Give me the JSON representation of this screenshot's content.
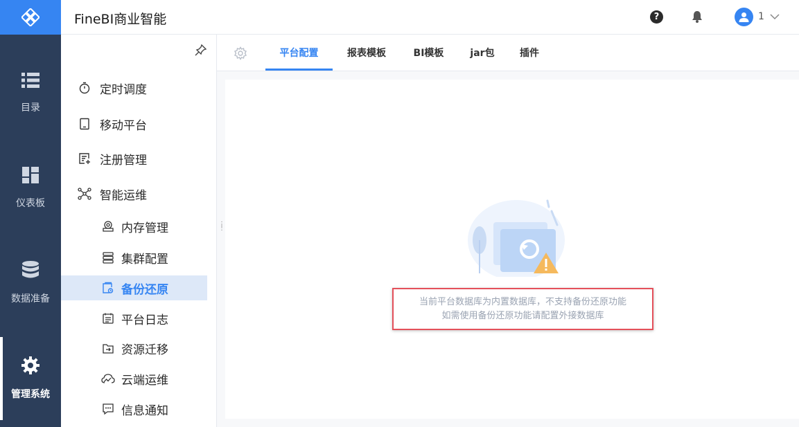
{
  "app": {
    "title": "FineBI商业智能"
  },
  "rail": {
    "items": [
      {
        "label": "目录",
        "icon": "list-icon"
      },
      {
        "label": "仪表板",
        "icon": "dashboard-icon"
      },
      {
        "label": "数据准备",
        "icon": "database-icon"
      },
      {
        "label": "管理系统",
        "icon": "gear-icon",
        "active": true
      }
    ]
  },
  "header": {
    "help_icon": "?",
    "user_label": "1"
  },
  "sidebar": {
    "items": [
      {
        "label": "定时调度",
        "icon": "timer-icon"
      },
      {
        "label": "移动平台",
        "icon": "tablet-icon"
      },
      {
        "label": "注册管理",
        "icon": "register-icon"
      },
      {
        "label": "智能运维",
        "icon": "network-icon"
      },
      {
        "label": "内存管理",
        "icon": "memory-icon"
      },
      {
        "label": "集群配置",
        "icon": "cluster-icon"
      },
      {
        "label": "备份还原",
        "icon": "backup-icon",
        "active": true
      },
      {
        "label": "平台日志",
        "icon": "log-icon"
      },
      {
        "label": "资源迁移",
        "icon": "migrate-icon"
      },
      {
        "label": "云端运维",
        "icon": "cloud-ops-icon"
      },
      {
        "label": "信息通知",
        "icon": "message-icon"
      }
    ]
  },
  "tabs": [
    {
      "label": "平台配置",
      "active": true
    },
    {
      "label": "报表模板"
    },
    {
      "label": "BI模板"
    },
    {
      "label": "jar包"
    },
    {
      "label": "插件"
    }
  ],
  "message": {
    "line1": "当前平台数据库为内置数据库，不支持备份还原功能",
    "line2": "如需使用备份还原功能请配置外接数据库"
  },
  "colors": {
    "accent": "#3685f2",
    "rail_bg": "#2c3e5a",
    "highlight_border": "#e4505a",
    "active_bg": "#dde8f8"
  }
}
